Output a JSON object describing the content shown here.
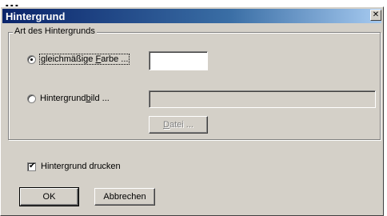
{
  "window": {
    "clipped_heading": "...",
    "title": "Hintergrund",
    "close_glyph": "✕"
  },
  "group": {
    "legend": "Art des Hintergrunds",
    "options": [
      {
        "label_before": "gleichmäßige ",
        "accel": "F",
        "label_after": "arbe ...",
        "checked": true
      },
      {
        "label_before": "Hintergrund",
        "accel": "b",
        "label_after": "ild  ...",
        "checked": false
      }
    ],
    "color_field_value": "",
    "image_path_value": "",
    "file_button": {
      "accel": "D",
      "rest": "atei ..."
    }
  },
  "print_checkbox": {
    "label": "Hintergrund drucken",
    "checked": true,
    "check_glyph": "✔"
  },
  "buttons": {
    "ok": "OK",
    "cancel": "Abbrechen"
  },
  "colors": {
    "dialog_bg": "#d4d0c8",
    "titlebar_start": "#0a246a",
    "titlebar_end": "#a6caf0"
  },
  "icons": [
    "close-icon",
    "radio-icon",
    "checkbox-icon"
  ]
}
